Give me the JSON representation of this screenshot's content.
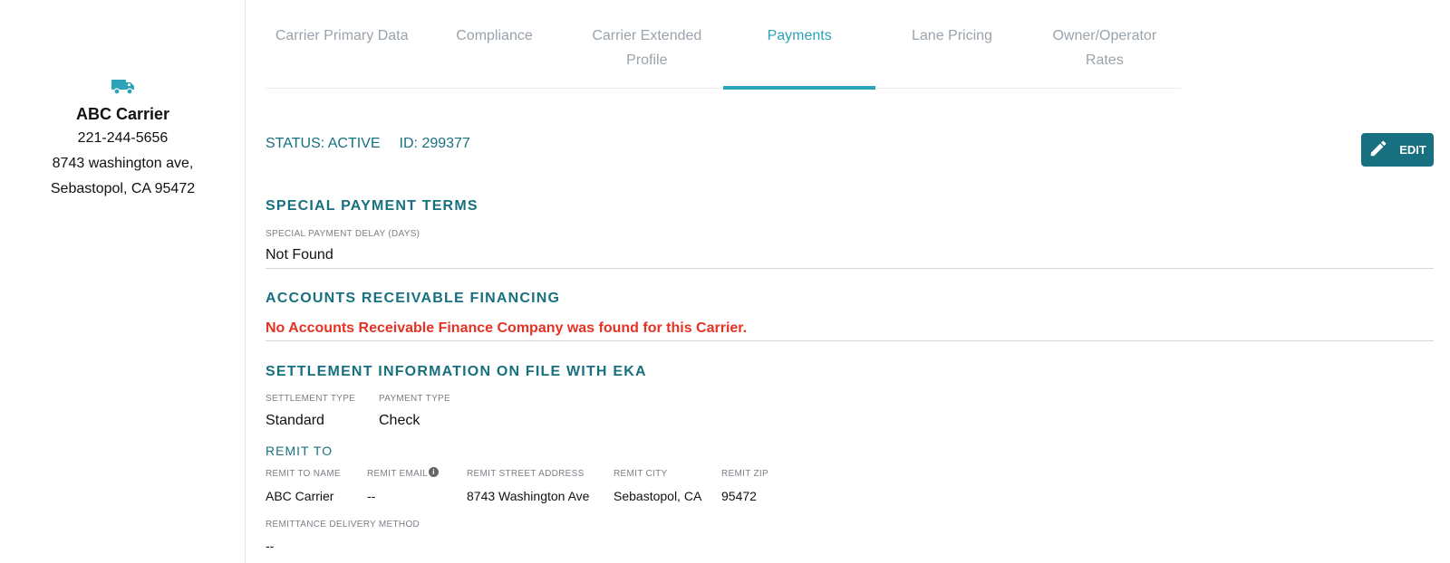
{
  "carrier": {
    "name": "ABC Carrier",
    "phone": "221-244-5656",
    "address_line1": "8743 washington ave,",
    "address_line2": "Sebastopol, CA 95472",
    "icon": "truck-icon"
  },
  "tabs": [
    {
      "label_1": "Carrier Primary Data",
      "label_2": ""
    },
    {
      "label_1": "Compliance",
      "label_2": ""
    },
    {
      "label_1": "Carrier Extended",
      "label_2": "Profile"
    },
    {
      "label_1": "Payments",
      "label_2": ""
    },
    {
      "label_1": "Lane Pricing",
      "label_2": ""
    },
    {
      "label_1": "Owner/Operator",
      "label_2": "Rates"
    }
  ],
  "active_tab": "Payments",
  "status": {
    "status_text": "STATUS: ACTIVE",
    "id_text": "ID: 299377"
  },
  "edit_button": {
    "label": "EDIT",
    "icon": "pencil-icon"
  },
  "special_payment_terms": {
    "title": "SPECIAL PAYMENT TERMS",
    "delay_label": "SPECIAL PAYMENT DELAY (DAYS)",
    "delay_value": "Not Found"
  },
  "ar_financing": {
    "title": "ACCOUNTS RECEIVABLE FINANCING",
    "message": "No Accounts Receivable Finance Company was found for this Carrier."
  },
  "settlement": {
    "title": "SETTLEMENT INFORMATION ON FILE WITH EKA",
    "settlement_type_label": "SETTLEMENT TYPE",
    "settlement_type_value": "Standard",
    "payment_type_label": "PAYMENT TYPE",
    "payment_type_value": "Check",
    "remit_to_title": "REMIT TO",
    "remit_name_label": "REMIT TO NAME",
    "remit_name_value": "ABC Carrier",
    "remit_email_label": "REMIT EMAIL",
    "remit_email_value": "--",
    "remit_street_label": "REMIT STREET ADDRESS",
    "remit_street_value": "8743 Washington Ave",
    "remit_city_label": "REMIT CITY",
    "remit_city_value": "Sebastopol, CA",
    "remit_zip_label": "REMIT ZIP",
    "remit_zip_value": "95472",
    "delivery_method_label": "REMITTANCE DELIVERY METHOD",
    "delivery_method_value": "--"
  },
  "colors": {
    "accent": "#2ba4b9",
    "primary_dark": "#17707f",
    "error": "#e53224",
    "tab_inactive": "#9aa3ab"
  }
}
